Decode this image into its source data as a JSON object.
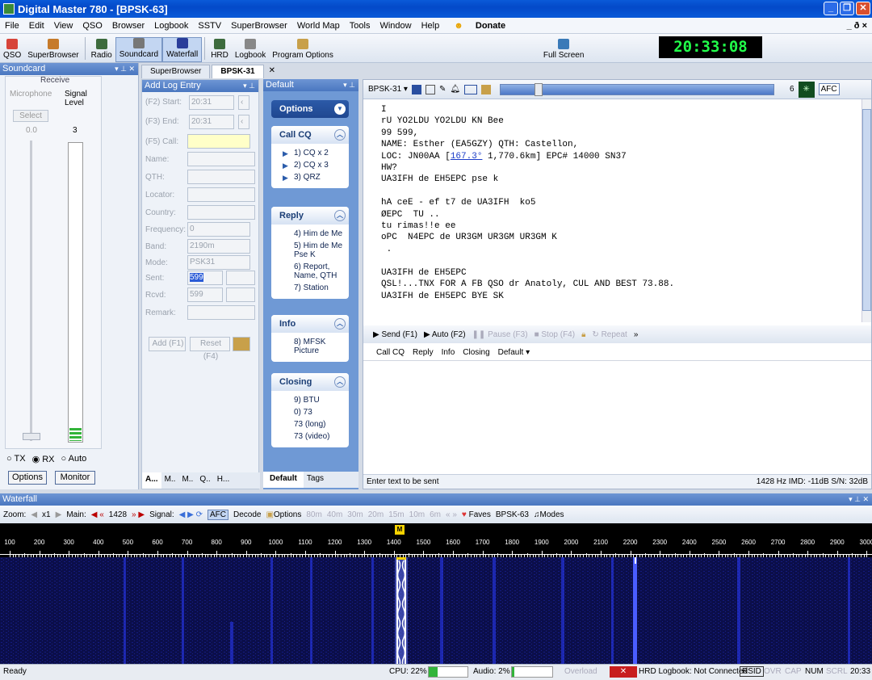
{
  "window": {
    "title": "Digital Master 780 - [BPSK-63]",
    "buttons": [
      "_",
      "❐",
      "✕"
    ]
  },
  "menu": [
    "File",
    "Edit",
    "View",
    "QSO",
    "Browser",
    "Logbook",
    "SSTV",
    "SuperBrowser",
    "World Map",
    "Tools",
    "Window",
    "Help"
  ],
  "menu_donate": "Donate",
  "menu_right": "_ ð ×",
  "toolbar": [
    "QSO",
    "SuperBrowser",
    "Radio",
    "Soundcard",
    "Waterfall",
    "HRD",
    "Logbook",
    "Program Options"
  ],
  "toolbar_fullscreen": "Full Screen",
  "clock": "20:33:08",
  "soundcard": {
    "title": "Soundcard",
    "receive": "Receive",
    "microphone": "Microphone",
    "signal_level": "Signal Level",
    "select": "Select",
    "mic_val": "0.0",
    "sig_val": "3",
    "tx": "TX",
    "rx": "RX",
    "auto": "Auto",
    "options": "Options",
    "monitor": "Monitor"
  },
  "tabs": {
    "superbrowser": "SuperBrowser",
    "bpsk": "BPSK-31"
  },
  "addlog": {
    "title": "Add Log Entry",
    "start_label": "(F2) Start:",
    "start": "20:31",
    "end_label": "(F3) End:",
    "end": "20:31",
    "call": "(F5) Call:",
    "name": "Name:",
    "qth": "QTH:",
    "locator": "Locator:",
    "country": "Country:",
    "frequency": "Frequency:",
    "freq_val": "0",
    "band": "Band:",
    "band_val": "2190m",
    "mode": "Mode:",
    "mode_val": "PSK31",
    "sent": "Sent:",
    "sent_val": "599",
    "rcvd": "Rcvd:",
    "rcvd_val": "599",
    "remark": "Remark:",
    "add": "Add (F1)",
    "reset": "Reset (F4)",
    "bottom_tabs": [
      "A...",
      "M..",
      "M..",
      "Q..",
      "H..."
    ]
  },
  "macros": {
    "title": "Default",
    "options": "Options",
    "groups": [
      {
        "name": "Call CQ",
        "items": [
          "1) CQ x 2",
          "2) CQ x 3",
          "3) QRZ"
        ]
      },
      {
        "name": "Reply",
        "items": [
          "4) Him de Me",
          "5) Him de Me Pse K",
          "6) Report, Name, QTH",
          "7) Station"
        ]
      },
      {
        "name": "Info",
        "items": [
          "8) MFSK Picture"
        ]
      },
      {
        "name": "Closing",
        "items": [
          "9) BTU",
          "0) 73",
          "73 (long)",
          "73 (video)"
        ]
      }
    ],
    "tab_default": "Default",
    "tab_tags": "Tags"
  },
  "rx": {
    "mode": "BPSK-31",
    "afc": "AFC",
    "level": "6",
    "text": "I\nrU YO2LDU YO2LDU KN Bee\n99 599,\nNAME: Esther (EA5GZY) QTH: Castellon,\nLOC: JN00AA [167.3° 1,770.6km] EPC# 14000 SN37\nHW?\nUA3IFH de EH5EPC pse k\n\nhA ceE - ef t7 de UA3IFH  ko5\nØEPC  TU ..\ntu rimas!!e ee\noPC  N4EPC de UR3GM UR3GM UR3GM K\n .\n\nUA3IFH de EH5EPC\nQSL!...TNX FOR A FB QSO dr Anatoly, CUL AND BEST 73.88.\nUA3IFH de EH5EPC BYE SK"
  },
  "tx": {
    "send": "Send (F1)",
    "auto": "Auto (F2)",
    "pause": "Pause (F3)",
    "stop": "Stop (F4)",
    "repeat": "Repeat",
    "macro_tabs": [
      "Call CQ",
      "Reply",
      "Info",
      "Closing"
    ],
    "default": "Default",
    "placeholder": "Enter text to be sent",
    "stats": "1428 Hz  IMD: -11dB  S/N: 32dB"
  },
  "waterfall": {
    "title": "Waterfall",
    "zoom": "Zoom:",
    "zoom_val": "x1",
    "main": "Main:",
    "main_val": "1428",
    "signal": "Signal:",
    "afc": "AFC",
    "decode": "Decode",
    "options": "Options",
    "bands": [
      "80m",
      "40m",
      "30m",
      "20m",
      "15m",
      "10m",
      "6m"
    ],
    "faves": "Faves",
    "mode": "BPSK-63",
    "modes": "Modes",
    "marker": "M",
    "scale": [
      "100",
      "200",
      "300",
      "400",
      "500",
      "600",
      "700",
      "800",
      "900",
      "1000",
      "1100",
      "1200",
      "1300",
      "1400",
      "1500",
      "1600",
      "1700",
      "1800",
      "1900",
      "2000",
      "2100",
      "2200",
      "2300",
      "2400",
      "2500",
      "2600",
      "2700",
      "2800",
      "2900",
      "3000"
    ]
  },
  "status": {
    "ready": "Ready",
    "cpu": "CPU: 22%",
    "audio": "Audio: 2%",
    "overload": "Overload",
    "logbook": "HRD Logbook: Not Connected",
    "rsid": "RSID",
    "ovr": "OVR",
    "cap": "CAP",
    "num": "NUM",
    "scrl": "SCRL",
    "time": "20:33"
  },
  "colors": {
    "title_bar": "#0a5ad8",
    "panel_header": "#4a77c0",
    "clock_text": "#21ff4a",
    "waterfall_bg": "#0b0e4a"
  }
}
